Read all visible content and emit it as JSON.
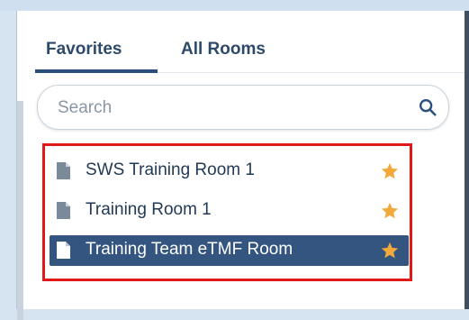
{
  "tabs": {
    "favorites_label": "Favorites",
    "all_rooms_label": "All Rooms",
    "active": "Favorites"
  },
  "search": {
    "placeholder": "Search",
    "value": "",
    "icon": "search-icon"
  },
  "rooms": [
    {
      "label": "SWS Training Room 1",
      "icon": "document-icon",
      "favorite": true,
      "selected": false
    },
    {
      "label": "Training Room 1",
      "icon": "document-icon",
      "favorite": true,
      "selected": false
    },
    {
      "label": "Training Team eTMF Room",
      "icon": "document-icon",
      "favorite": true,
      "selected": true
    }
  ],
  "colors": {
    "accent": "#2b4f7c",
    "selected_row": "#34557f",
    "star": "#f2a93b",
    "highlight_outline": "#e01818",
    "background": "#d9e6f3"
  }
}
